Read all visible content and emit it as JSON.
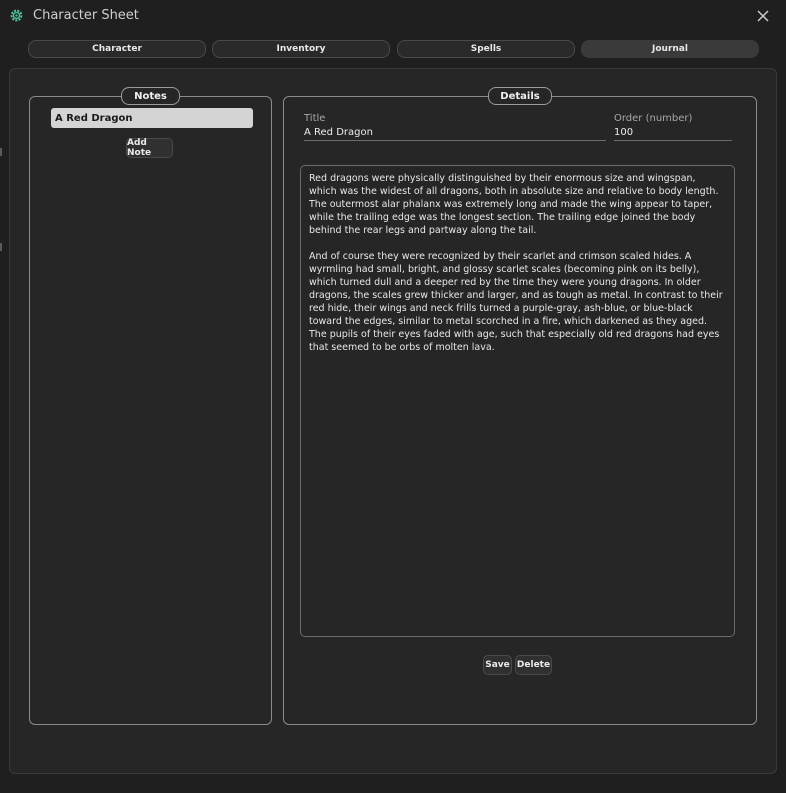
{
  "window": {
    "title": "Character Sheet",
    "icon": "gear-icon",
    "close_icon": "close-icon"
  },
  "tabs": [
    {
      "label": "Character",
      "active": false
    },
    {
      "label": "Inventory",
      "active": false
    },
    {
      "label": "Spells",
      "active": false
    },
    {
      "label": "Journal",
      "active": true
    }
  ],
  "notes_panel": {
    "legend": "Notes",
    "items": [
      "A Red Dragon"
    ],
    "add_button": "Add Note"
  },
  "details_panel": {
    "legend": "Details",
    "title_label": "Title",
    "title_value": "A Red Dragon",
    "order_label": "Order (number)",
    "order_value": "100",
    "body": "Red dragons were physically distinguished by their enormous size and wingspan, which was the widest of all dragons, both in absolute size and relative to body length. The outermost alar phalanx was extremely long and made the wing appear to taper, while the trailing edge was the longest section. The trailing edge joined the body behind the rear legs and partway along the tail.\n\nAnd of course they were recognized by their scarlet and crimson scaled hides. A wyrmling had small, bright, and glossy scarlet scales (becoming pink on its belly), which turned dull and a deeper red by the time they were young dragons. In older dragons, the scales grew thicker and larger, and as tough as metal. In contrast to their red hide, their wings and neck frills turned a purple-gray, ash-blue, or blue-black toward the edges, similar to metal scorched in a fire, which darkened as they aged. The pupils of their eyes faded with age, such that especially old red dragons had eyes that seemed to be orbs of molten lava.",
    "save_button": "Save",
    "delete_button": "Delete"
  },
  "colors": {
    "background": "#1f1f1f",
    "panel": "#262626",
    "selected_item": "#d4d4d4",
    "app_icon": "#4fc3a1"
  }
}
